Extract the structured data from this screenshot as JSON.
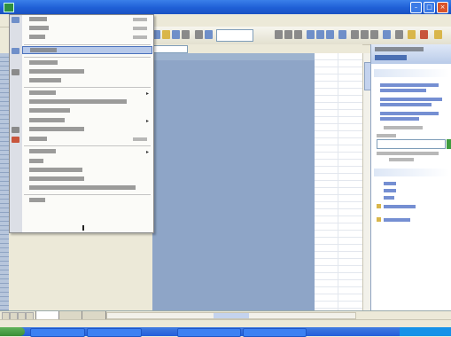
{
  "window": {
    "title": ""
  },
  "menubar": {
    "items": [
      "",
      "",
      "",
      "",
      "",
      "",
      "",
      "",
      ""
    ]
  },
  "dropdown": {
    "items": [
      {
        "label": "",
        "shortcut": ""
      },
      {
        "label": "",
        "shortcut": ""
      },
      {
        "label": "",
        "shortcut": ""
      },
      {
        "label": "",
        "highlighted": true
      },
      {
        "label": ""
      },
      {
        "label": ""
      },
      {
        "label": ""
      },
      {
        "label": "",
        "submenu": true
      },
      {
        "label": ""
      },
      {
        "label": ""
      },
      {
        "label": "",
        "submenu": true
      },
      {
        "label": ""
      },
      {
        "label": "",
        "shortcut": ""
      },
      {
        "label": "",
        "submenu": true
      },
      {
        "label": ""
      },
      {
        "label": ""
      },
      {
        "label": ""
      },
      {
        "label": ""
      },
      {
        "label": ""
      }
    ]
  },
  "taskpane": {
    "title": "",
    "subtitle": ""
  },
  "sheet_tabs": [
    "",
    "",
    ""
  ],
  "status": {
    "text": ""
  },
  "colors": {
    "accent": "#1f5fd6",
    "highlight": "#b7c9ea",
    "grid": "#8ea5c7"
  },
  "icons": [
    "app-icon",
    "minimize-icon",
    "maximize-icon",
    "close-icon",
    "start-icon"
  ]
}
